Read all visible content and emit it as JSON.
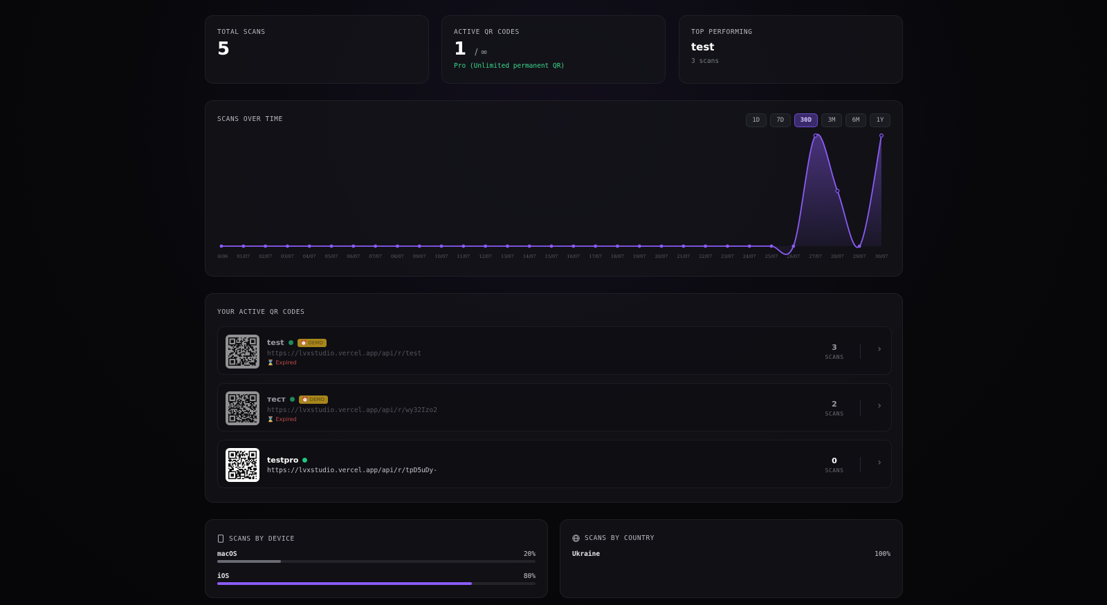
{
  "stats": {
    "total_scans_label": "TOTAL SCANS",
    "total_scans_value": "5",
    "active_label": "ACTIVE QR CODES",
    "active_value": "1",
    "active_limit": "/ ∞",
    "active_plan": "Pro (Unlimited permanent QR)",
    "top_label": "TOP PERFORMING",
    "top_name": "test",
    "top_scans": "3 scans"
  },
  "chart_card": {
    "title": "SCANS OVER TIME",
    "ranges": [
      "1D",
      "7D",
      "30D",
      "3M",
      "6M",
      "1Y"
    ],
    "active_range": "30D"
  },
  "chart_data": {
    "type": "area",
    "title": "SCANS OVER TIME",
    "x": [
      "30/06",
      "01/07",
      "02/07",
      "03/07",
      "04/07",
      "05/07",
      "06/07",
      "07/07",
      "08/07",
      "09/07",
      "10/07",
      "11/07",
      "12/07",
      "13/07",
      "14/07",
      "15/07",
      "16/07",
      "17/07",
      "18/07",
      "19/07",
      "20/07",
      "21/07",
      "22/07",
      "23/07",
      "24/07",
      "25/07",
      "26/07",
      "27/07",
      "28/07",
      "29/07",
      "30/07"
    ],
    "series": [
      {
        "values": [
          0,
          0,
          0,
          0,
          0,
          0,
          0,
          0,
          0,
          0,
          0,
          0,
          0,
          0,
          0,
          0,
          0,
          0,
          0,
          0,
          0,
          0,
          0,
          0,
          0,
          0,
          0,
          2,
          1,
          0,
          2
        ]
      }
    ],
    "ylim": [
      0,
      2
    ],
    "grid": false,
    "color": "#8b5cf6"
  },
  "qr_section": {
    "title": "YOUR ACTIVE QR CODES",
    "scans_label": "SCANS",
    "items": [
      {
        "name": "test",
        "badge": "⏰ DEMO",
        "url": "https://lvxstudio.vercel.app/api/r/test",
        "status": "⌛ Expired",
        "scans": "3"
      },
      {
        "name": "тест",
        "badge": "⏰ DEMO",
        "url": "https://lvxstudio.vercel.app/api/r/wy32Izo2",
        "status": "⌛ Expired",
        "scans": "2"
      },
      {
        "name": "testpro",
        "badge": "",
        "url": "https://lvxstudio.vercel.app/api/r/tpD5uDy-",
        "status": "",
        "scans": "0"
      }
    ]
  },
  "device": {
    "title": "SCANS BY DEVICE",
    "rows": [
      {
        "label": "macOS",
        "pct": "20%",
        "value": 0.2,
        "color": "#6b6b74"
      },
      {
        "label": "iOS",
        "pct": "80%",
        "value": 0.8,
        "color": "#8b5cf6"
      }
    ]
  },
  "country": {
    "title": "SCANS BY COUNTRY",
    "rows": [
      {
        "label": "Ukraine",
        "pct": "100%"
      }
    ]
  },
  "colors": {
    "accent": "#8b5cf6",
    "green": "#22c77d",
    "demo": "#a8861c",
    "expired": "#c04a4a"
  }
}
